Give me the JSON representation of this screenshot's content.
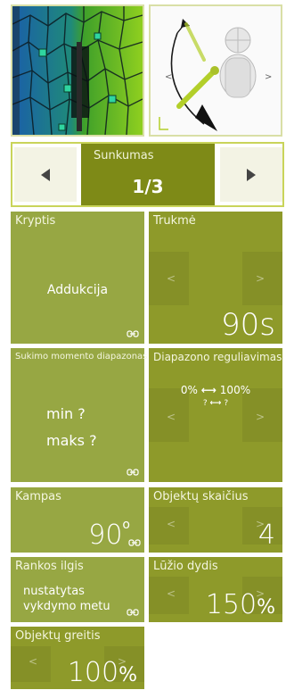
{
  "difficulty": {
    "label": "Sunkumas",
    "value": "1/3"
  },
  "tiles": {
    "direction": {
      "label": "Kryptis",
      "value": "Addukcija"
    },
    "duration": {
      "label": "Trukmė",
      "value": "90s"
    },
    "torque": {
      "label": "Sukimo momento diapazonas",
      "min": "min ?",
      "max": "maks ?"
    },
    "range_adjust": {
      "label": "Diapazono reguliavimas",
      "row1_left": "0%",
      "row1_right": "100%",
      "row2_left": "?",
      "row2_right": "?"
    },
    "angle": {
      "label": "Kampas",
      "value": "90",
      "unit": "o"
    },
    "object_count": {
      "label": "Objektų skaičius",
      "value": "4"
    },
    "arm_length": {
      "label": "Rankos ilgis",
      "value": "nustatytas vykdymo metu"
    },
    "break_size": {
      "label": "Lūžio dydis",
      "value": "150",
      "unit": "%"
    },
    "object_speed": {
      "label": "Objektų greitis",
      "value": "100",
      "unit": "%"
    }
  },
  "colors": {
    "tile": "#8e9a2a",
    "tile_light": "#97a743",
    "accent_border": "#c9d45a"
  },
  "icons": [
    "chevron-left-icon",
    "chevron-right-icon",
    "link-icon"
  ]
}
